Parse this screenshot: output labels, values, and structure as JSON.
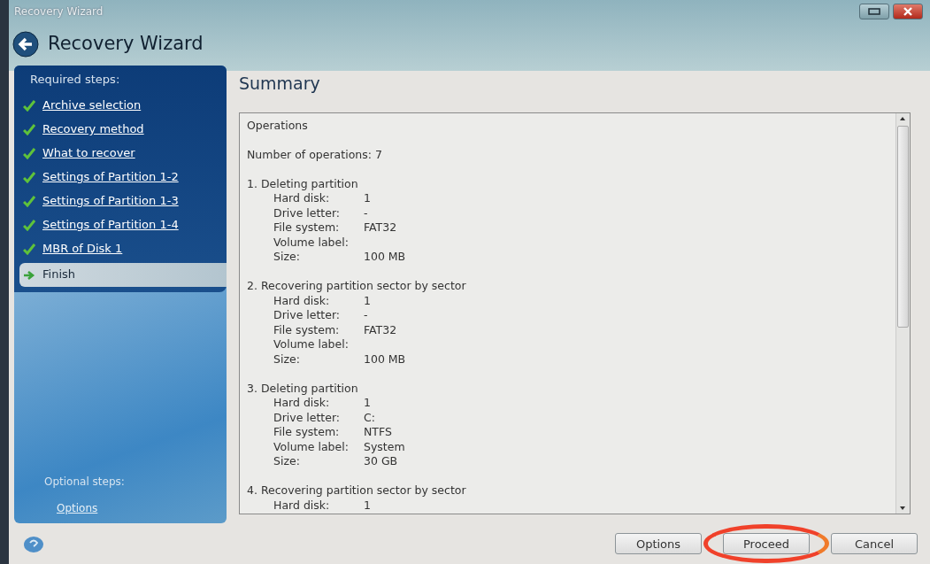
{
  "window": {
    "title": "Recovery Wizard"
  },
  "header": {
    "title": "Recovery Wizard"
  },
  "sidebar": {
    "required_title": "Required steps:",
    "steps": [
      {
        "label": "Archive selection",
        "completed": true,
        "selected": false
      },
      {
        "label": "Recovery method",
        "completed": true,
        "selected": false
      },
      {
        "label": "What to recover",
        "completed": true,
        "selected": false
      },
      {
        "label": "Settings of Partition 1-2",
        "completed": true,
        "selected": false
      },
      {
        "label": "Settings of Partition 1-3",
        "completed": true,
        "selected": false
      },
      {
        "label": "Settings of Partition 1-4",
        "completed": true,
        "selected": false
      },
      {
        "label": "MBR of Disk 1",
        "completed": true,
        "selected": false
      },
      {
        "label": "Finish",
        "completed": false,
        "selected": true
      }
    ],
    "optional_title": "Optional steps:",
    "optional_steps": [
      {
        "label": "Options"
      }
    ]
  },
  "content": {
    "title": "Summary",
    "heading": "Operations",
    "count": "Number of operations: 7",
    "operations": [
      {
        "title": "1. Deleting partition",
        "fields": [
          {
            "label": "Hard disk:",
            "value": "1"
          },
          {
            "label": "Drive letter:",
            "value": "-"
          },
          {
            "label": "File system:",
            "value": "FAT32"
          },
          {
            "label": "Volume label:"
          },
          {
            "label": "Size:",
            "value": "100 MB"
          }
        ]
      },
      {
        "title": "2. Recovering partition sector by sector",
        "fields": [
          {
            "label": "Hard disk:",
            "value": "1"
          },
          {
            "label": "Drive letter:",
            "value": "-"
          },
          {
            "label": "File system:",
            "value": "FAT32"
          },
          {
            "label": "Volume label:"
          },
          {
            "label": "Size:",
            "value": "100 MB"
          }
        ]
      },
      {
        "title": "3. Deleting partition",
        "fields": [
          {
            "label": "Hard disk:",
            "value": "1"
          },
          {
            "label": "Drive letter:",
            "value": "C:"
          },
          {
            "label": "File system:",
            "value": "NTFS"
          },
          {
            "label": "Volume label:",
            "value": "System"
          },
          {
            "label": "Size:",
            "value": "30 GB"
          }
        ]
      },
      {
        "title": "4. Recovering partition sector by sector",
        "fields": [
          {
            "label": "Hard disk:",
            "value": "1"
          }
        ]
      }
    ]
  },
  "buttons": [
    {
      "label": "Options",
      "highlighted": false
    },
    {
      "label": "Proceed",
      "highlighted": true
    },
    {
      "label": "Cancel",
      "highlighted": false
    }
  ]
}
